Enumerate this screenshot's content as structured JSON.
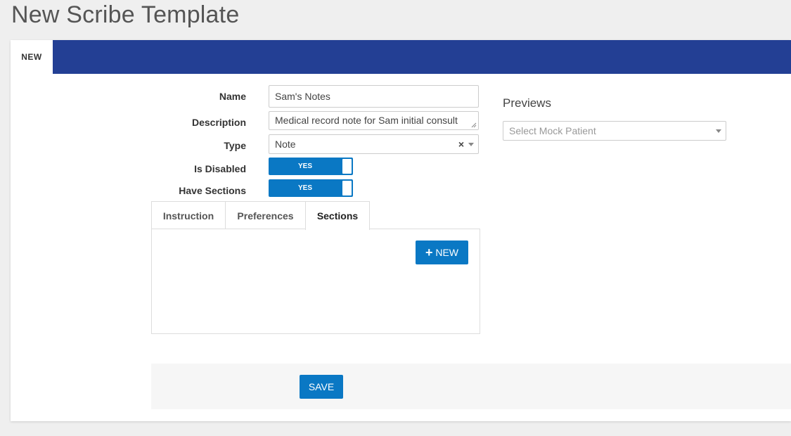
{
  "page": {
    "title": "New Scribe Template"
  },
  "tabs": {
    "active_tab": "NEW"
  },
  "form": {
    "name_label": "Name",
    "name_value": "Sam's Notes",
    "description_label": "Description",
    "description_value": "Medical record note for Sam initial consult",
    "type_label": "Type",
    "type_value": "Note",
    "type_clear": "×",
    "is_disabled_label": "Is Disabled",
    "is_disabled_value": "YES",
    "have_sections_label": "Have Sections",
    "have_sections_value": "YES"
  },
  "subtabs": {
    "items": [
      {
        "label": "Instruction"
      },
      {
        "label": "Preferences"
      },
      {
        "label": "Sections"
      }
    ],
    "active": "Sections"
  },
  "sections_panel": {
    "new_button_label": "NEW",
    "new_button_icon": "plus-icon"
  },
  "previews": {
    "title": "Previews",
    "select_placeholder": "Select Mock Patient"
  },
  "footer": {
    "save_label": "SAVE"
  },
  "colors": {
    "header_bar": "#233f94",
    "primary_button": "#0a78c4",
    "toggle_on": "#0a78c4"
  }
}
